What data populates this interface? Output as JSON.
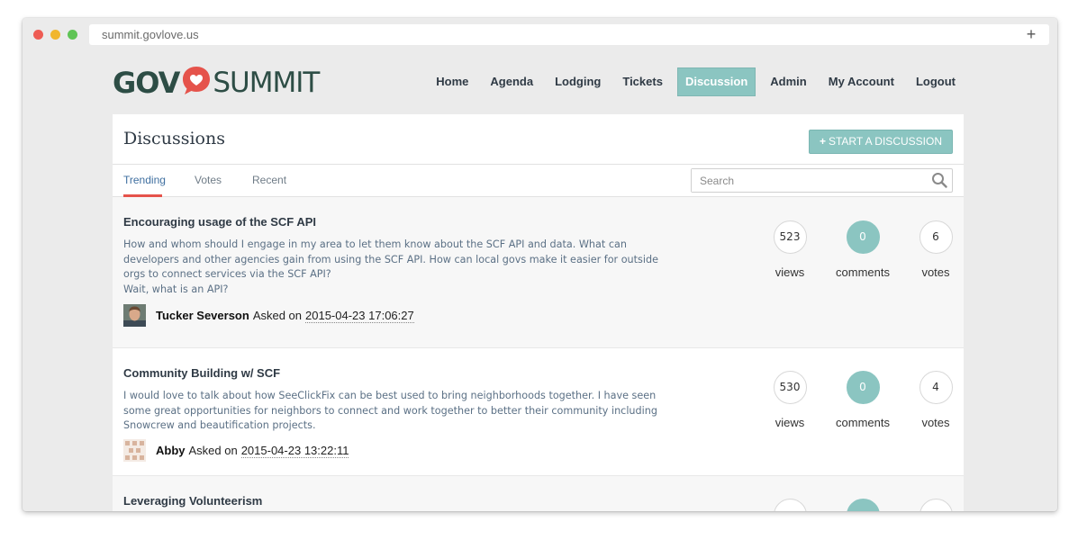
{
  "browser": {
    "url": "summit.govlove.us",
    "new_tab": "+"
  },
  "logo": {
    "gov": "GOV",
    "summit": "SUMMIT"
  },
  "nav": {
    "items": [
      "Home",
      "Agenda",
      "Lodging",
      "Tickets",
      "Discussion",
      "Admin",
      "My Account",
      "Logout"
    ],
    "active": "Discussion"
  },
  "page": {
    "title": "Discussions",
    "start_button": "START A DISCUSSION",
    "start_button_plus": "+"
  },
  "tabs": {
    "trending": "Trending",
    "votes": "Votes",
    "recent": "Recent",
    "active": "Trending"
  },
  "search": {
    "placeholder": "Search",
    "value": ""
  },
  "discussions": [
    {
      "title": "Encouraging usage of the SCF API",
      "body": "How and whom should I engage in my area to let them know about the SCF API and data. What can developers and other agencies gain from using the SCF API. How can local govs make it easier for outside orgs to connect services via the SCF API?",
      "extra": "Wait, what is an API?",
      "author": "Tucker Severson",
      "asked": "Asked on",
      "date": "2015-04-23 17:06:27",
      "views": "523",
      "comments": "0",
      "votes": "6",
      "views_label": "views",
      "comments_label": "comments",
      "votes_label": "votes"
    },
    {
      "title": "Community Building w/ SCF",
      "body": "I would love to talk about how SeeClickFix can be best used to bring neighborhoods together. I have seen some great opportunities for neighbors to connect and work together to better their community including Snowcrew and beautification projects.",
      "author": "Abby",
      "asked": "Asked on",
      "date": "2015-04-23 13:22:11",
      "views": "530",
      "comments": "0",
      "votes": "4",
      "views_label": "views",
      "comments_label": "comments",
      "votes_label": "votes"
    },
    {
      "title": "Leveraging Volunteerism"
    }
  ],
  "colors": {
    "accent": "#8bc5c1",
    "tab_underline": "#e5534b",
    "logo": "#2d4d45",
    "heart": "#e5534b"
  }
}
